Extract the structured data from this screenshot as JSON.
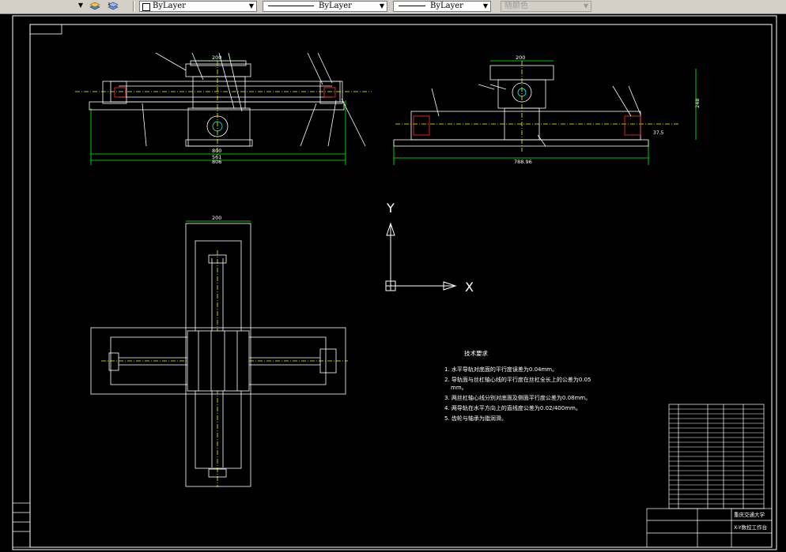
{
  "toolbar": {
    "color_control": "ByLayer",
    "linetype_control": "ByLayer",
    "lineweight_control": "ByLayer",
    "plotstyle_control": "随颜色"
  },
  "drawing": {
    "tech_title": "技术要求",
    "requirements": [
      "1. 水平导轨对底面的平行度误差为0.04mm。",
      "2. 导轨面与丝杠轴心线的平行度在丝杠全长上的公差为0.05",
      "mm。",
      "3. 两丝杠轴心线分别对底面及侧面平行度公差为0.08mm。",
      "4. 两导轨在水平方向上的直线度公差为0.02/400mm。",
      "5. 齿轮与轴承为脂润滑。"
    ],
    "dimensions": {
      "front_top_width": "200",
      "front_overall": "800",
      "front_total": "806",
      "front_bottom": "561",
      "side_top_width": "200",
      "side_total": "788.96",
      "side_height": "248",
      "side_small": "37.5",
      "plan_top_width": "200"
    },
    "axis": {
      "y_label": "Y",
      "x_label": "X"
    },
    "title_block": {
      "school": "重庆交通大学",
      "drawing_name": "X-Y数控工作台"
    }
  }
}
